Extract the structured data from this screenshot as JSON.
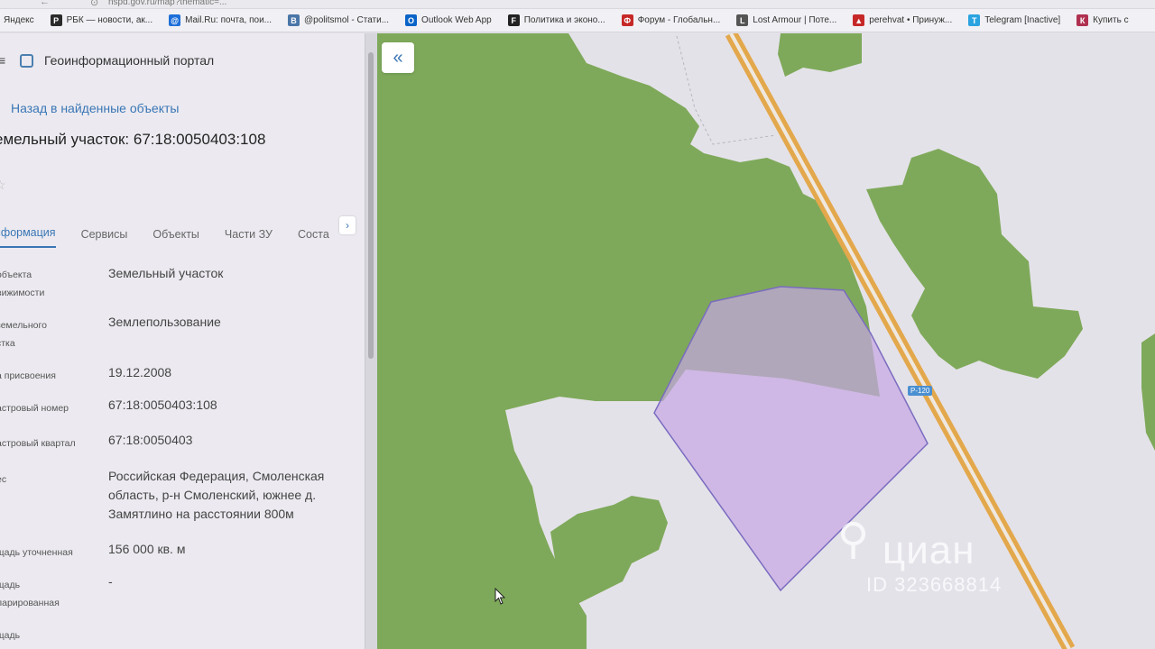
{
  "browser": {
    "url": "nspd.gov.ru/map?thematic=...",
    "bookmarks": [
      {
        "label": "Яндекс",
        "color": "#e53935",
        "glyph": ""
      },
      {
        "label": "РБК — новости, ак...",
        "color": "#2a2a2a",
        "glyph": "Р"
      },
      {
        "label": "Mail.Ru: почта, пои...",
        "color": "#1e6fd9",
        "glyph": "@"
      },
      {
        "label": "@politsmol - Стати...",
        "color": "#4a76a8",
        "glyph": "В"
      },
      {
        "label": "Outlook Web App",
        "color": "#0a64c8",
        "glyph": "O"
      },
      {
        "label": "Политика и эконо...",
        "color": "#222222",
        "glyph": "F"
      },
      {
        "label": "Форум - Глобальн...",
        "color": "#c62828",
        "glyph": "Ф"
      },
      {
        "label": "Lost Armour | Поте...",
        "color": "#555555",
        "glyph": "L"
      },
      {
        "label": "perehvat • Принуж...",
        "color": "#c62828",
        "glyph": "▲"
      },
      {
        "label": "Telegram [Inactive]",
        "color": "#2aa3e0",
        "glyph": "T"
      },
      {
        "label": "Купить с",
        "color": "#b03050",
        "glyph": "К"
      }
    ]
  },
  "panel": {
    "portal_title": "Геоинформационный портал",
    "back_link": "Назад в найденные объекты",
    "title": "емельный участок: 67:18:0050403:108",
    "tabs": [
      "нформация",
      "Сервисы",
      "Объекты",
      "Части ЗУ",
      "Соста"
    ],
    "fields": [
      {
        "label": "объекта\nвижимости",
        "value": "Земельный участок"
      },
      {
        "label": "земельного\nстка",
        "value": "Землепользование"
      },
      {
        "label": "а присвоения",
        "value": "19.12.2008"
      },
      {
        "label": "астровый номер",
        "value": "67:18:0050403:108"
      },
      {
        "label": "астровый квартал",
        "value": "67:18:0050403"
      },
      {
        "label": "ес",
        "value": "Российская Федерация, Смоленская область, р-н Смоленский, южнее д. Замятлино на расстоянии 800м"
      },
      {
        "label": "щадь уточненная",
        "value": "156 000 кв. м"
      },
      {
        "label": "щадь\nларированная",
        "value": "-"
      },
      {
        "label": "щадь",
        "value": ""
      }
    ]
  },
  "map": {
    "road_label": "Р-120",
    "watermark_brand": "циан",
    "watermark_id": "ID 323668814",
    "colors": {
      "forest": "#7ea95a",
      "background": "#e4e2e9",
      "parcel": "#c6a7e3",
      "road": "#e3a84c"
    }
  }
}
